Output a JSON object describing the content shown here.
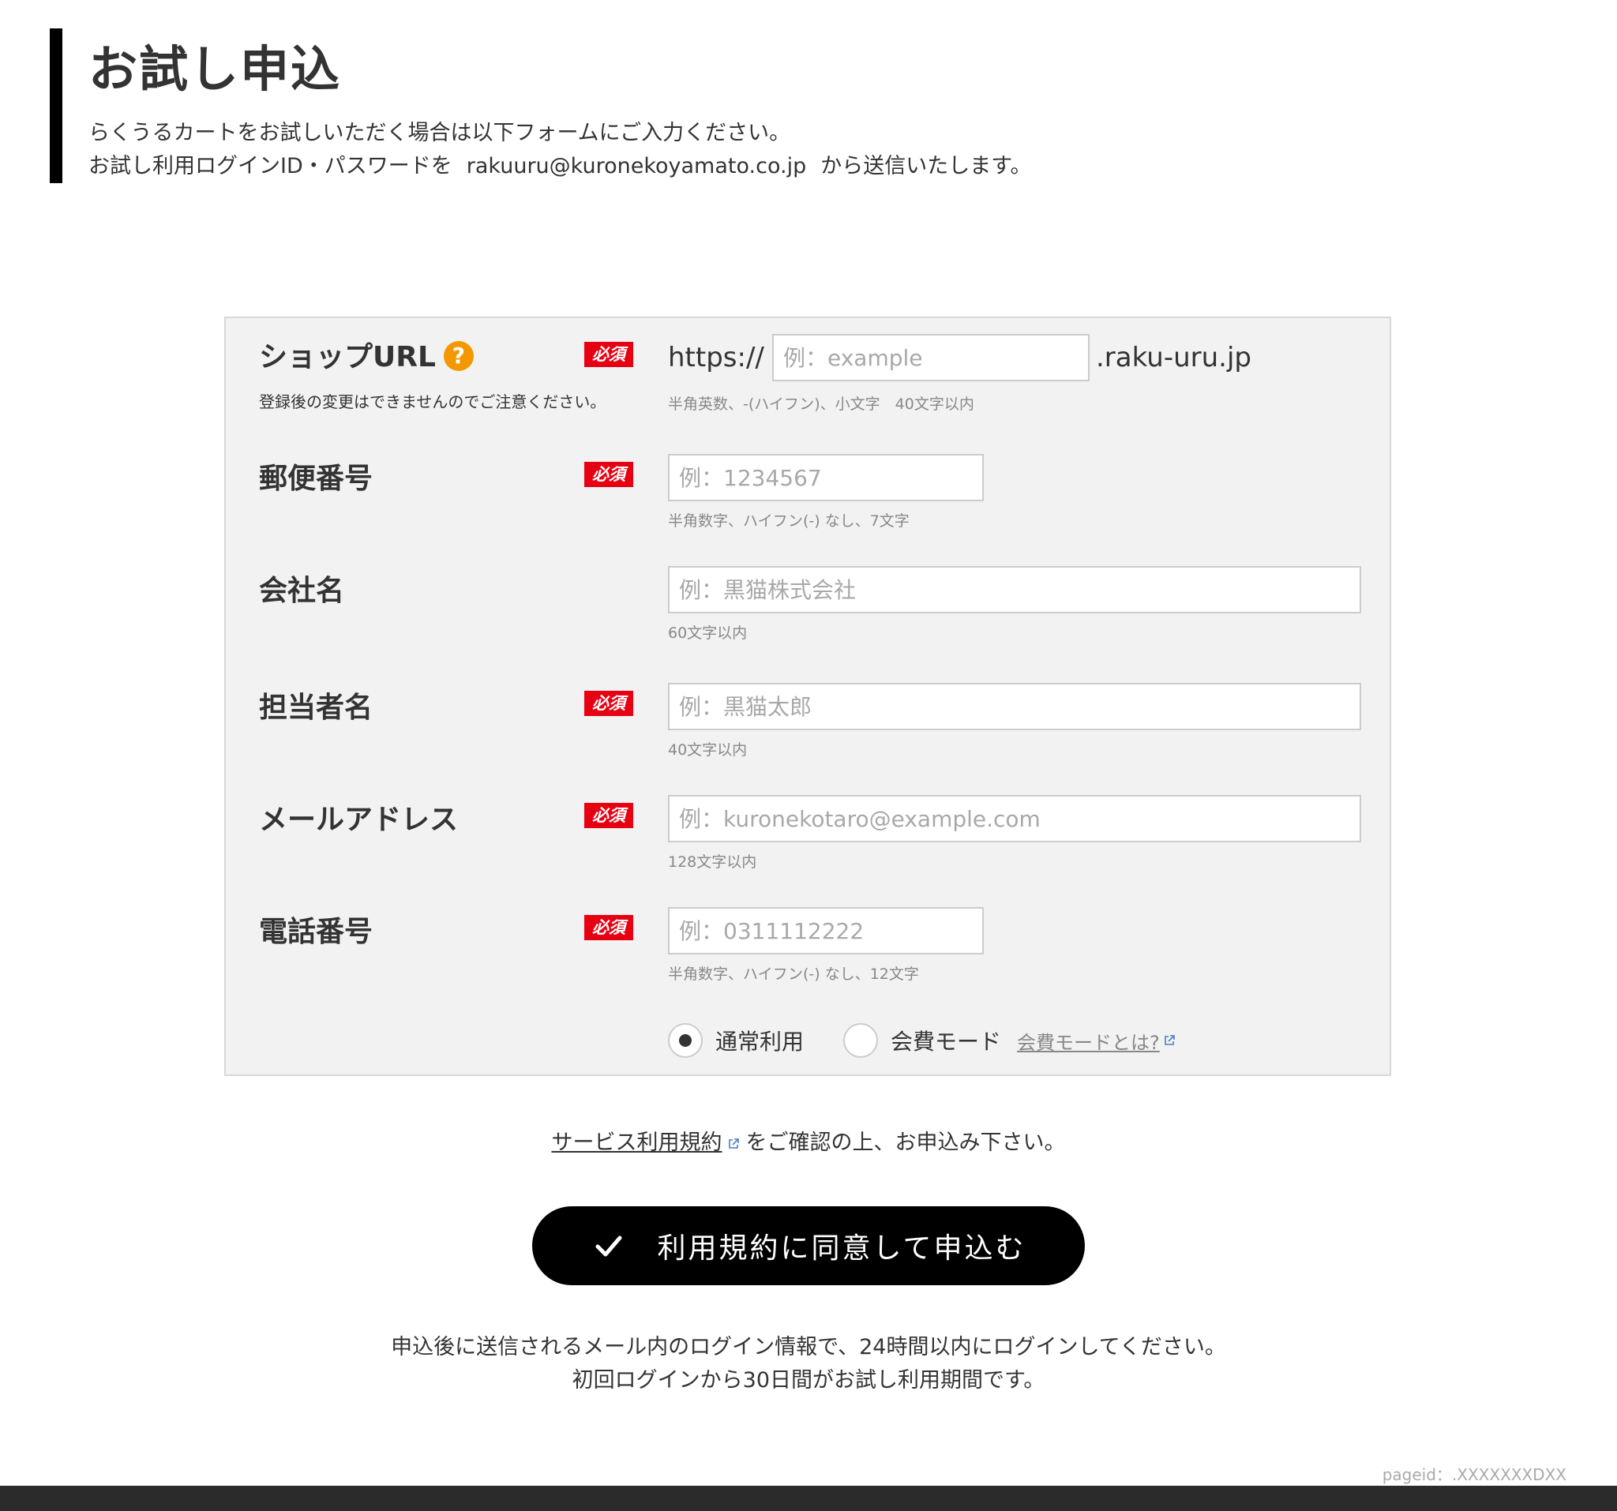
{
  "header": {
    "title": "お試し申込",
    "intro_line1": "らくうるカートをお試しいただく場合は以下フォームにご入力ください。",
    "intro_line2_prefix": "お試し利用ログインID・パスワードを",
    "intro_email": "rakuuru@kuronekoyamato.co.jp",
    "intro_line2_suffix": "から送信いたします。"
  },
  "form": {
    "required_badge": "必須",
    "shop_url": {
      "label": "ショップURL",
      "help_icon": "?",
      "note": "登録後の変更はできませんのでご注意ください。",
      "prefix": "https://",
      "placeholder": "例：example",
      "suffix": ".raku-uru.jp",
      "hint": "半角英数、-(ハイフン)、小文字　40文字以内"
    },
    "postal_code": {
      "label": "郵便番号",
      "placeholder": "例：1234567",
      "hint": "半角数字、ハイフン(-) なし、7文字"
    },
    "company": {
      "label": "会社名",
      "placeholder": "例：黒猫株式会社",
      "hint": "60文字以内"
    },
    "contact_name": {
      "label": "担当者名",
      "placeholder": "例：黒猫太郎",
      "hint": "40文字以内"
    },
    "email": {
      "label": "メールアドレス",
      "placeholder": "例：kuronekotaro@example.com",
      "hint": "128文字以内"
    },
    "phone": {
      "label": "電話番号",
      "placeholder": "例：0311112222",
      "hint": "半角数字、ハイフン(-) なし、12文字"
    },
    "mode": {
      "option_normal": "通常利用",
      "option_member": "会費モード",
      "member_link": "会費モードとは?",
      "selected": "通常利用"
    }
  },
  "terms": {
    "link": "サービス利用規約",
    "text": "をご確認の上、お申込み下さい。"
  },
  "submit": {
    "label": "利用規約に同意して申込む"
  },
  "after_note": {
    "line1": "申込後に送信されるメール内のログイン情報で、24時間以内にログインしてください。",
    "line2": "初回ログインから30日間がお試し利用期間です。"
  },
  "footer": {
    "pageid": "pageid：.XXXXXXXDXX"
  },
  "colors": {
    "accent": "#000000",
    "required": "#e60012",
    "help": "#f39800",
    "panel": "#f2f2f2"
  },
  "icons": {
    "help": "question-icon",
    "external": "external-link-icon",
    "check": "check-icon"
  }
}
